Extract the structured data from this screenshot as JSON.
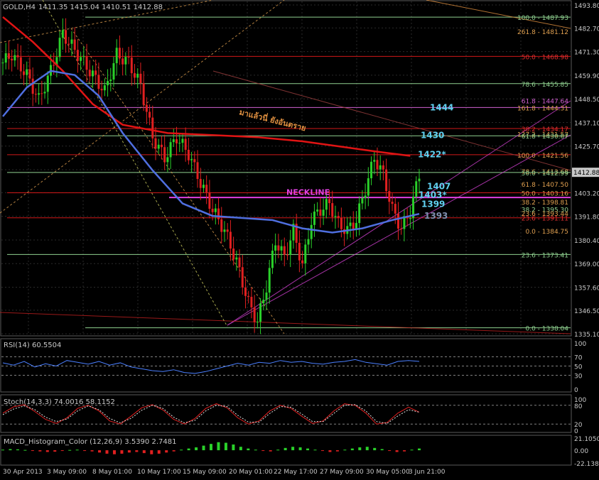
{
  "header": {
    "symbol": "GOLD,H4",
    "ohlc": "1411.35 1415.04 1410.51 1412.88"
  },
  "chart_data": [
    {
      "type": "candlestick",
      "panel": "price",
      "title": "GOLD,H4  1411.35 1415.04 1410.51 1412.88",
      "ylim": [
        1335.15,
        1493.8
      ],
      "y_ticks": [
        1493.8,
        1482.7,
        1471.3,
        1459.9,
        1448.5,
        1437.1,
        1425.7,
        1414.3,
        1403.2,
        1391.8,
        1380.4,
        1369.0,
        1357.6,
        1346.5,
        1335.1
      ],
      "current_price": 1412.88,
      "x_ticks": [
        "30 Apr 2013",
        "3 May 09:00",
        "8 May 01:00",
        "10 May 17:00",
        "15 May 09:00",
        "20 May 01:00",
        "22 May 17:00",
        "27 May 09:00",
        "30 May 05:00",
        "3 Jun 21:00"
      ],
      "price_path": [
        [
          0,
          1466
        ],
        [
          3,
          1470
        ],
        [
          8,
          1460
        ],
        [
          12,
          1448
        ],
        [
          16,
          1462
        ],
        [
          20,
          1480
        ],
        [
          26,
          1468
        ],
        [
          30,
          1460
        ],
        [
          34,
          1452
        ],
        [
          38,
          1470
        ],
        [
          42,
          1466
        ],
        [
          46,
          1455
        ],
        [
          50,
          1430
        ],
        [
          54,
          1420
        ],
        [
          58,
          1430
        ],
        [
          62,
          1422
        ],
        [
          66,
          1408
        ],
        [
          70,
          1395
        ],
        [
          74,
          1385
        ],
        [
          78,
          1370
        ],
        [
          82,
          1350
        ],
        [
          85,
          1341
        ],
        [
          88,
          1358
        ],
        [
          91,
          1380
        ],
        [
          94,
          1372
        ],
        [
          97,
          1385
        ],
        [
          100,
          1368
        ],
        [
          103,
          1390
        ],
        [
          106,
          1395
        ],
        [
          109,
          1398
        ],
        [
          112,
          1388
        ],
        [
          115,
          1385
        ],
        [
          118,
          1390
        ],
        [
          121,
          1405
        ],
        [
          124,
          1420
        ],
        [
          127,
          1412
        ],
        [
          130,
          1395
        ],
        [
          133,
          1386
        ],
        [
          136,
          1394
        ],
        [
          139,
          1412
        ]
      ],
      "moving_averages": [
        {
          "name": "ma-red",
          "color": "#e01414",
          "points": [
            [
              0,
              1488
            ],
            [
              10,
              1476
            ],
            [
              20,
              1462
            ],
            [
              30,
              1446
            ],
            [
              40,
              1436
            ],
            [
              55,
              1432
            ],
            [
              70,
              1431
            ],
            [
              85,
              1430
            ],
            [
              100,
              1428
            ],
            [
              115,
              1425
            ],
            [
              125,
              1423
            ],
            [
              136,
              1421
            ]
          ]
        },
        {
          "name": "ma-blue",
          "color": "#4f6fe0",
          "points": [
            [
              0,
              1440
            ],
            [
              8,
              1454
            ],
            [
              16,
              1462
            ],
            [
              24,
              1460
            ],
            [
              32,
              1450
            ],
            [
              40,
              1432
            ],
            [
              50,
              1414
            ],
            [
              60,
              1398
            ],
            [
              70,
              1392
            ],
            [
              80,
              1391
            ],
            [
              90,
              1390
            ],
            [
              100,
              1386
            ],
            [
              110,
              1384
            ],
            [
              120,
              1386
            ],
            [
              130,
              1390
            ],
            [
              139,
              1393
            ]
          ]
        }
      ],
      "horizontal_lines": [
        {
          "price": 1487.93,
          "color": "#8fd08f"
        },
        {
          "price": 1468.98,
          "color": "#d01818"
        },
        {
          "price": 1455.85,
          "color": "#8fd08f"
        },
        {
          "price": 1444.31,
          "color": "#d060d0"
        },
        {
          "price": 1434.17,
          "color": "#d01818"
        },
        {
          "price": 1430.67,
          "color": "#8fd08f"
        },
        {
          "price": 1421.56,
          "color": "#d01818"
        },
        {
          "price": 1412.99,
          "color": "#8fd08f"
        },
        {
          "price": 1403.16,
          "color": "#d01818"
        },
        {
          "price": 1400.9,
          "color": "#e040e0"
        },
        {
          "price": 1391.11,
          "color": "#d01818"
        },
        {
          "price": 1373.41,
          "color": "#8fd08f"
        },
        {
          "price": 1338.04,
          "color": "#8fd08f"
        }
      ],
      "fib_labels": [
        {
          "text": "100.0 - 1487.93",
          "price": 1487.93,
          "color": "#8fd08f"
        },
        {
          "text": "261.8 - 1481.12",
          "price": 1481.12,
          "color": "#e0a050"
        },
        {
          "text": "50.0 - 1468.98",
          "price": 1468.98,
          "color": "#e03030"
        },
        {
          "text": "78.6 - 1455.85",
          "price": 1455.85,
          "color": "#8fd08f"
        },
        {
          "text": "61.8 - 1447.64",
          "price": 1447.64,
          "color": "#d060d0"
        },
        {
          "text": "161.8 - 1444.31",
          "price": 1444.31,
          "color": "#e0a050"
        },
        {
          "text": "38.2 - 1434.17",
          "price": 1434.17,
          "color": "#e03030"
        },
        {
          "text": "127.2 - 1431.57",
          "price": 1431.57,
          "color": "#e0a050"
        },
        {
          "text": "61.8 - 1430.67",
          "price": 1430.67,
          "color": "#8fd08f"
        },
        {
          "text": "100.0 - 1421.56",
          "price": 1421.56,
          "color": "#e0a050"
        },
        {
          "text": "78.6 - 1413.68",
          "price": 1413.68,
          "color": "#e0a050"
        },
        {
          "text": "50.0 - 1412.99",
          "price": 1412.99,
          "color": "#8fd08f"
        },
        {
          "text": "61.8 - 1407.50",
          "price": 1407.5,
          "color": "#e0a050"
        },
        {
          "text": "50.0 - 1403.16",
          "price": 1403.16,
          "color": "#e0a050"
        },
        {
          "text": "38.2 - 1398.81",
          "price": 1398.81,
          "color": "#e0a050"
        },
        {
          "text": "38.2 - 1395.30",
          "price": 1395.3,
          "color": "#8fd08f"
        },
        {
          "text": "23.6 - 1393.44",
          "price": 1393.44,
          "color": "#e0a050"
        },
        {
          "text": "23.6 - 1391.11",
          "price": 1391.11,
          "color": "#e03030"
        },
        {
          "text": "0.0 - 1384.75",
          "price": 1384.75,
          "color": "#e0a050"
        },
        {
          "text": "23.6 - 1373.41",
          "price": 1373.41,
          "color": "#8fd08f"
        },
        {
          "text": "0.0 - 1338.04",
          "price": 1338.04,
          "color": "#8fd08f"
        }
      ],
      "annotations": [
        {
          "text": "1444",
          "price": 1444.3,
          "color": "#60d0f0"
        },
        {
          "text": "1430",
          "price": 1431.0,
          "color": "#60d0f0"
        },
        {
          "text": "1422*",
          "price": 1421.6,
          "color": "#60d0f0"
        },
        {
          "text": "1407",
          "price": 1406.3,
          "color": "#60d0f0"
        },
        {
          "text": "1403*",
          "price": 1402.1,
          "color": "#60d0f0"
        },
        {
          "text": "1399",
          "price": 1397.6,
          "color": "#60d0f0"
        },
        {
          "text": "1393",
          "price": 1392.1,
          "color": "#8090b0"
        },
        {
          "text": "NECKLINE",
          "price": 1403.5,
          "color": "#e040e0"
        },
        {
          "text": "มาแล้วนี่ ยังอันตราย",
          "price": 1441.0,
          "color": "#e09040"
        }
      ]
    },
    {
      "type": "line",
      "panel": "rsi",
      "title": "RSI(14) 60.5504",
      "ylim": [
        0,
        100
      ],
      "y_ticks": [
        100,
        70,
        50,
        30,
        0
      ],
      "levels": [
        70,
        50,
        30
      ],
      "series": [
        {
          "color": "#4a7fff",
          "values": [
            57,
            52,
            60,
            48,
            55,
            50,
            62,
            58,
            54,
            60,
            52,
            57,
            48,
            44,
            40,
            38,
            42,
            36,
            34,
            38,
            44,
            50,
            56,
            52,
            58,
            56,
            62,
            58,
            60,
            56,
            54,
            58,
            60,
            64,
            58,
            55,
            52,
            60,
            62,
            60
          ]
        }
      ]
    },
    {
      "type": "line",
      "panel": "stochastic",
      "title": "Stoch(14,3,3) 74.0016 58.1152",
      "ylim": [
        0,
        100
      ],
      "y_ticks": [
        100,
        80,
        20,
        0
      ],
      "levels": [
        80,
        20
      ],
      "series": [
        {
          "color": "#e02020",
          "values": [
            55,
            75,
            82,
            60,
            35,
            22,
            40,
            70,
            80,
            62,
            30,
            20,
            45,
            72,
            82,
            65,
            35,
            20,
            38,
            70,
            85,
            72,
            40,
            20,
            30,
            62,
            80,
            70,
            45,
            22,
            30,
            62,
            85,
            80,
            55,
            20,
            25,
            55,
            74,
            58
          ]
        },
        {
          "color": "#e0e0e0",
          "values": [
            50,
            68,
            78,
            66,
            42,
            28,
            36,
            62,
            78,
            66,
            38,
            24,
            38,
            64,
            80,
            70,
            42,
            24,
            32,
            62,
            80,
            76,
            48,
            26,
            26,
            54,
            76,
            74,
            52,
            28,
            28,
            54,
            80,
            82,
            62,
            28,
            22,
            46,
            66,
            58
          ]
        }
      ]
    },
    {
      "type": "bar",
      "panel": "macd",
      "title": "MACD_Histogram_Color (12,26,9) 3.5390 2.7481",
      "ylim": [
        -22.1382,
        21.105
      ],
      "y_ticks": [
        21.105,
        0.0,
        -22.1382
      ],
      "values": [
        1,
        2,
        1.5,
        0.5,
        -1,
        -2,
        -3,
        -2.5,
        -1,
        0.5,
        1,
        -0.5,
        -2,
        -4,
        -6,
        -7,
        -6,
        -4,
        -3,
        -5,
        -7,
        -6,
        -4,
        -2,
        1,
        3,
        5,
        8,
        11,
        14,
        13,
        10,
        6,
        3,
        1,
        -1,
        -2,
        1,
        4,
        6,
        5,
        3,
        1,
        -1,
        -3,
        -2,
        1,
        3,
        5,
        6,
        4,
        2,
        -1,
        -3,
        -2,
        1,
        3
      ]
    }
  ],
  "y_axis_labels": {
    "price": [
      "1493.80",
      "1482.70",
      "1471.30",
      "1459.90",
      "1448.50",
      "1437.10",
      "1425.70",
      "1414.30",
      "1403.20",
      "1391.80",
      "1380.40",
      "1369.00",
      "1357.60",
      "1346.50",
      "1335.10"
    ],
    "current_price": "1412.88",
    "rsi": [
      "100",
      "70",
      "50",
      "30",
      "0"
    ],
    "stoch": [
      "100",
      "80",
      "20",
      "0"
    ],
    "macd": [
      "21.1050",
      "0.00",
      "-22.1382"
    ]
  },
  "colors": {
    "background": "#000000",
    "grid": "#2a2a2a",
    "bull_candle": "#2ad02a",
    "bear_candle": "#e02020",
    "axis_text": "#c8c8c8",
    "level_line": "#808080",
    "price_tag": "#c8c8c8"
  }
}
